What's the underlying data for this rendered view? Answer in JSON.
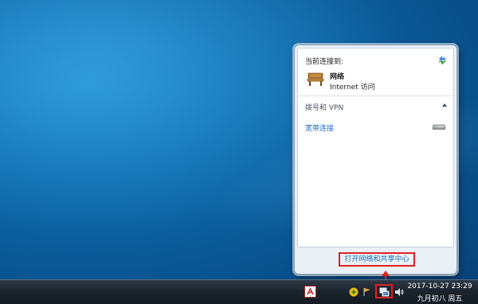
{
  "flyout": {
    "current_connection_label": "当前连接到:",
    "network": {
      "name": "网络",
      "access": "Internet 访问"
    },
    "section_title": "拨号和 VPN",
    "dialup_item": "宽带连接",
    "open_center_link": "打开网络和共享中心"
  },
  "taskbar": {
    "clock": {
      "time_line": "2017-10-27 23:29",
      "date_line": "九月初八 周五"
    }
  },
  "colors": {
    "highlight_red": "#e02020",
    "link_blue": "#1c6fc0"
  },
  "icons": [
    "refresh-icon",
    "bench-network-icon",
    "collapse-icon",
    "modem-icon",
    "network-tray-icon",
    "volume-icon"
  ]
}
